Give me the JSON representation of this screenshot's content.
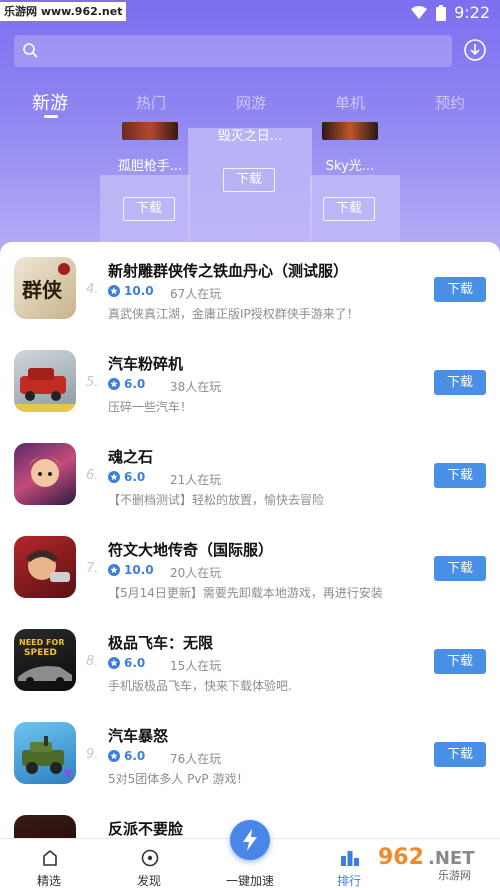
{
  "status": {
    "watermark": "乐游网 www.962.net",
    "time": "9:22"
  },
  "search": {
    "placeholder": ""
  },
  "tabs": [
    {
      "label": "新游",
      "active": true
    },
    {
      "label": "热门",
      "active": false
    },
    {
      "label": "网游",
      "active": false
    },
    {
      "label": "单机",
      "active": false
    },
    {
      "label": "预约",
      "active": false
    }
  ],
  "podium": {
    "left": {
      "name": "孤胆枪手...",
      "button": "下载"
    },
    "center": {
      "name": "毁灭之日...",
      "button": "下载"
    },
    "right": {
      "name": "Sky光...",
      "button": "下载"
    }
  },
  "games": [
    {
      "rank": "4.",
      "name": "新射雕群侠传之铁血丹心（测试服）",
      "rating": "10.0",
      "players": "67人在玩",
      "desc": "真武侠真江湖，金庸正版IP授权群侠手游来了！",
      "button": "下载",
      "icon": "wuxia-icon"
    },
    {
      "rank": "5.",
      "name": "汽车粉碎机",
      "rating": "6.0",
      "players": "38人在玩",
      "desc": "压碎一些汽车！",
      "button": "下载",
      "icon": "car-crusher-icon"
    },
    {
      "rank": "6.",
      "name": "魂之石",
      "rating": "6.0",
      "players": "21人在玩",
      "desc": "【不删档测试】轻松的放置，愉快去冒险",
      "button": "下载",
      "icon": "soul-stone-icon"
    },
    {
      "rank": "7.",
      "name": "符文大地传奇（国际服）",
      "rating": "10.0",
      "players": "20人在玩",
      "desc": "【5月14日更新】需要先卸载本地游戏，再进行安装",
      "button": "下载",
      "icon": "runeterra-icon"
    },
    {
      "rank": "8.",
      "name": "极品飞车：无限",
      "rating": "6.0",
      "players": "15人在玩",
      "desc": "手机版极品飞车，快来下载体验吧.",
      "button": "下载",
      "icon": "need-for-speed-icon"
    },
    {
      "rank": "9.",
      "name": "汽车暴怒",
      "rating": "6.0",
      "players": "76人在玩",
      "desc": "5对5团体多人 PvP 游戏！",
      "button": "下载",
      "icon": "car-rage-icon"
    },
    {
      "rank": "",
      "name": "反派不要脸",
      "rating": "",
      "players": "",
      "desc": "",
      "button": "",
      "icon": "villain-icon"
    }
  ],
  "bottom_nav": [
    {
      "label": "精选",
      "icon": "home-icon",
      "active": false
    },
    {
      "label": "发现",
      "icon": "discover-icon",
      "active": false
    },
    {
      "label": "一键加速",
      "icon": "lightning-icon",
      "active": false
    },
    {
      "label": "排行",
      "icon": "ranking-icon",
      "active": true
    }
  ],
  "watermark_bottom": "962.NET 乐游网",
  "colors": {
    "accent": "#4a8fe6",
    "hero_top": "#7c6ff0",
    "hero_bottom": "#b9b0f6"
  }
}
